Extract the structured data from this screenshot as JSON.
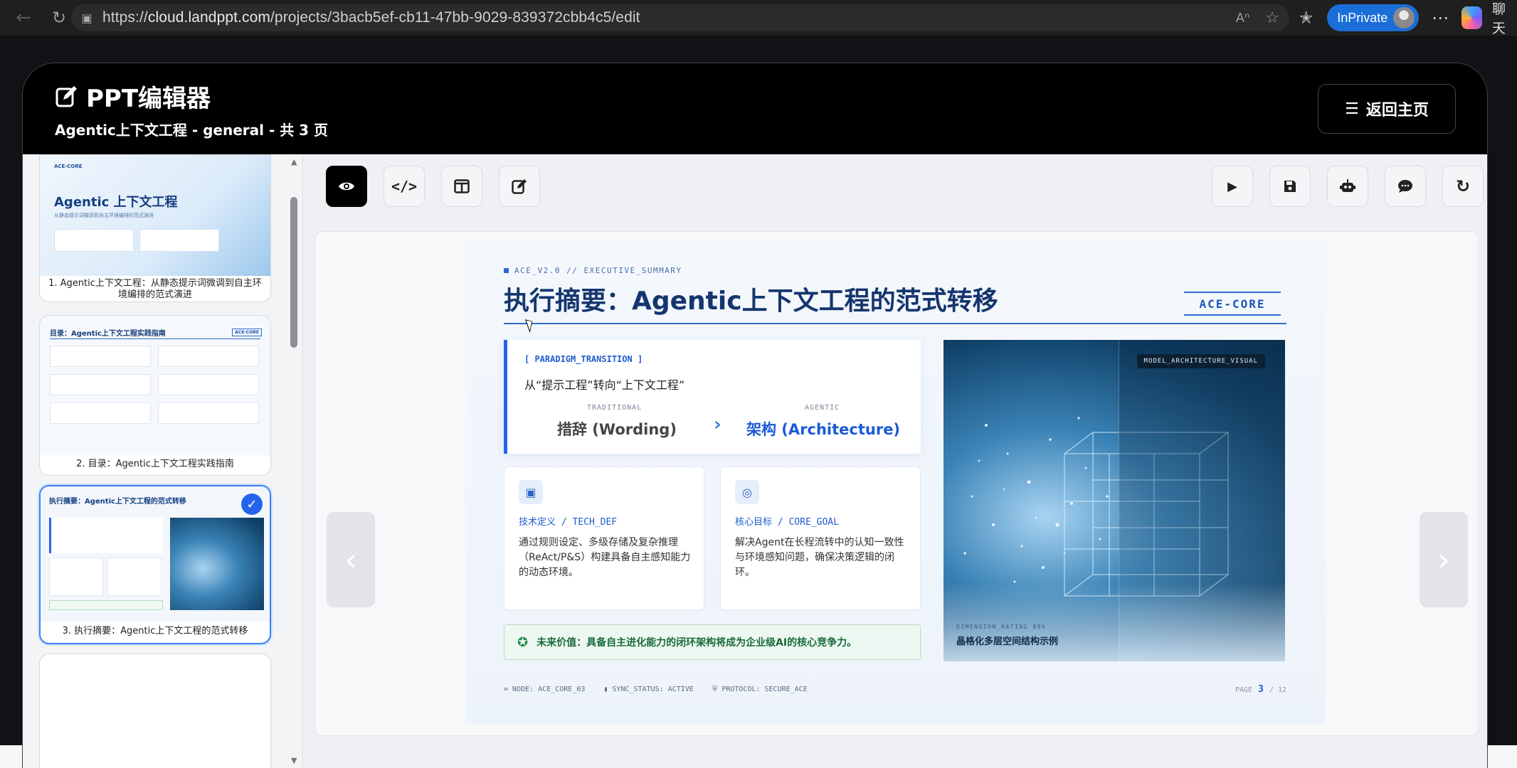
{
  "browser": {
    "url_prefix": "https://",
    "url_host": "cloud.landppt.com",
    "url_path": "/projects/3bacb5ef-cb11-47bb-9029-839372cbb4c5/edit",
    "inprivate_label": "InPrivate",
    "chat_label": "聊天"
  },
  "app": {
    "title": "PPT编辑器",
    "subtitle": "Agentic上下文工程 - general - 共 3 页",
    "home_button": "返回主页"
  },
  "thumbnails": [
    {
      "caption": "1. Agentic上下文工程：从静态提示词微调到自主环境编排的范式演进",
      "brand": "ACE-CORE",
      "title": "Agentic 上下文工程",
      "subtitle": "从静态提示词微调到自主环境编排的范式演进"
    },
    {
      "caption": "2. 目录：Agentic上下文工程实践指南",
      "title": "目录：Agentic上下文工程实践指南",
      "brand": "ACE-CORE"
    },
    {
      "caption": "3. 执行摘要：Agentic上下文工程的范式转移",
      "title": "执行摘要：Agentic上下文工程的范式转移",
      "selected": true
    }
  ],
  "toolbar": {
    "left": [
      {
        "name": "preview",
        "icon": "eye-icon",
        "active": true
      },
      {
        "name": "code",
        "icon": "code-icon",
        "active": false
      },
      {
        "name": "layout",
        "icon": "layout-columns-icon",
        "active": false
      },
      {
        "name": "edit",
        "icon": "edit-icon",
        "active": false
      }
    ],
    "right": [
      {
        "name": "play",
        "icon": "play-icon"
      },
      {
        "name": "save",
        "icon": "save-icon"
      },
      {
        "name": "ai-assistant",
        "icon": "robot-icon"
      },
      {
        "name": "comment",
        "icon": "comment-icon"
      },
      {
        "name": "refresh",
        "icon": "refresh-icon"
      }
    ]
  },
  "slide": {
    "top_tag": "ACE_V2.0 // EXECUTIVE_SUMMARY",
    "title": "执行摘要：Agentic上下文工程的范式转移",
    "badge": "ACE-CORE",
    "paradigm": {
      "tag": "[ PARADIGM_TRANSITION ]",
      "text": "从“提示工程”转向“上下文工程”",
      "traditional_label": "TRADITIONAL",
      "traditional_value": "措辞 (Wording)",
      "agentic_label": "AGENTIC",
      "agentic_value": "架构 (Architecture)"
    },
    "cards": [
      {
        "title": "技术定义 / TECH_DEF",
        "body": "通过规则设定、多级存储及复杂推理（ReAct/P&S）构建具备自主感知能力的动态环境。"
      },
      {
        "title": "核心目标 / CORE_GOAL",
        "body": "解决Agent在长程流转中的认知一致性与环境感知问题，确保决策逻辑的闭环。"
      }
    ],
    "future_value": "未来价值：具备自主进化能力的闭环架构将成为企业级AI的核心竞争力。",
    "visual": {
      "tag": "MODEL_ARCHITECTURE_VISUAL",
      "caption_small": "DIMENSION_RATING 89%",
      "caption": "晶格化多层空间结构示例"
    },
    "footer": {
      "node": "NODE: ACE_CORE_03",
      "sync": "SYNC_STATUS: ACTIVE",
      "protocol": "PROTOCOL: SECURE_ACE",
      "page_label": "PAGE",
      "page_current": "3",
      "page_total": "/ 12"
    }
  },
  "colors": {
    "accent": "#2563eb",
    "title_dark": "#15356e",
    "success": "#186a3b"
  }
}
